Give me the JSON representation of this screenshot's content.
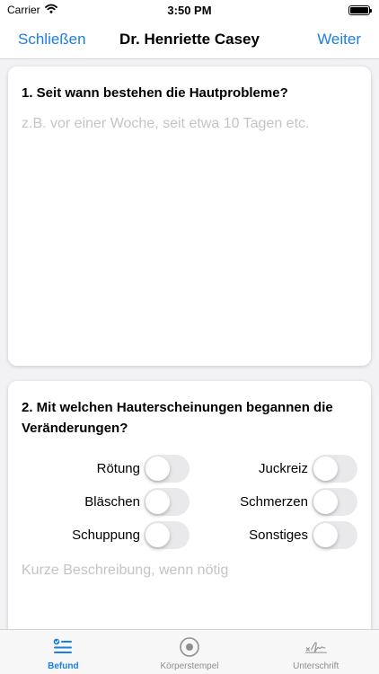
{
  "status_bar": {
    "carrier": "Carrier",
    "time": "3:50 PM"
  },
  "nav": {
    "close_label": "Schließen",
    "title": "Dr. Henriette Casey",
    "next_label": "Weiter"
  },
  "question1": {
    "title": "1. Seit wann bestehen die Hautprobleme?",
    "placeholder": "z.B. vor einer Woche, seit etwa 10 Tagen etc.",
    "value": ""
  },
  "question2": {
    "title": "2. Mit welchen Hauterscheinungen begannen die Veränderungen?",
    "toggles": [
      {
        "label": "Rötung",
        "on": false
      },
      {
        "label": "Juckreiz",
        "on": false
      },
      {
        "label": "Bläschen",
        "on": false
      },
      {
        "label": "Schmerzen",
        "on": false
      },
      {
        "label": "Schuppung",
        "on": false
      },
      {
        "label": "Sonstiges",
        "on": false
      }
    ],
    "placeholder": "Kurze Beschreibung, wenn nötig",
    "value": ""
  },
  "tabs": [
    {
      "label": "Befund",
      "icon": "checklist-icon",
      "active": true
    },
    {
      "label": "Körperstempel",
      "icon": "target-icon",
      "active": false
    },
    {
      "label": "Unterschrift",
      "icon": "signature-icon",
      "active": false
    }
  ],
  "colors": {
    "accent": "#1a7ee6",
    "inactive": "#8e8e93",
    "placeholder": "#c4c4c8",
    "switch_off": "#e9e9eb"
  }
}
